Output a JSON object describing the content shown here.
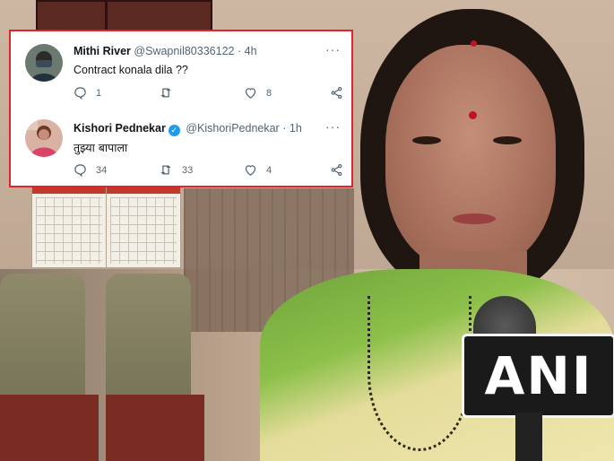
{
  "background": {
    "camera_brand": "ANI"
  },
  "tweets": [
    {
      "display_name": "Mithi River",
      "handle": "@Swapnil80336122",
      "separator": "·",
      "time": "4h",
      "text": "Contract konala dila ??",
      "more_label": "···",
      "verified": false,
      "replies": "1",
      "retweets": "",
      "likes": "8"
    },
    {
      "display_name": "Kishori Pednekar",
      "handle": "@KishoriPednekar",
      "separator": "·",
      "time": "1h",
      "text": "तुझ्या बापाला",
      "more_label": "···",
      "verified": true,
      "replies": "34",
      "retweets": "33",
      "likes": "4"
    }
  ],
  "colors": {
    "highlight_border": "#e0242c",
    "verified_badge": "#1d9bf0",
    "text_secondary": "#536471"
  }
}
